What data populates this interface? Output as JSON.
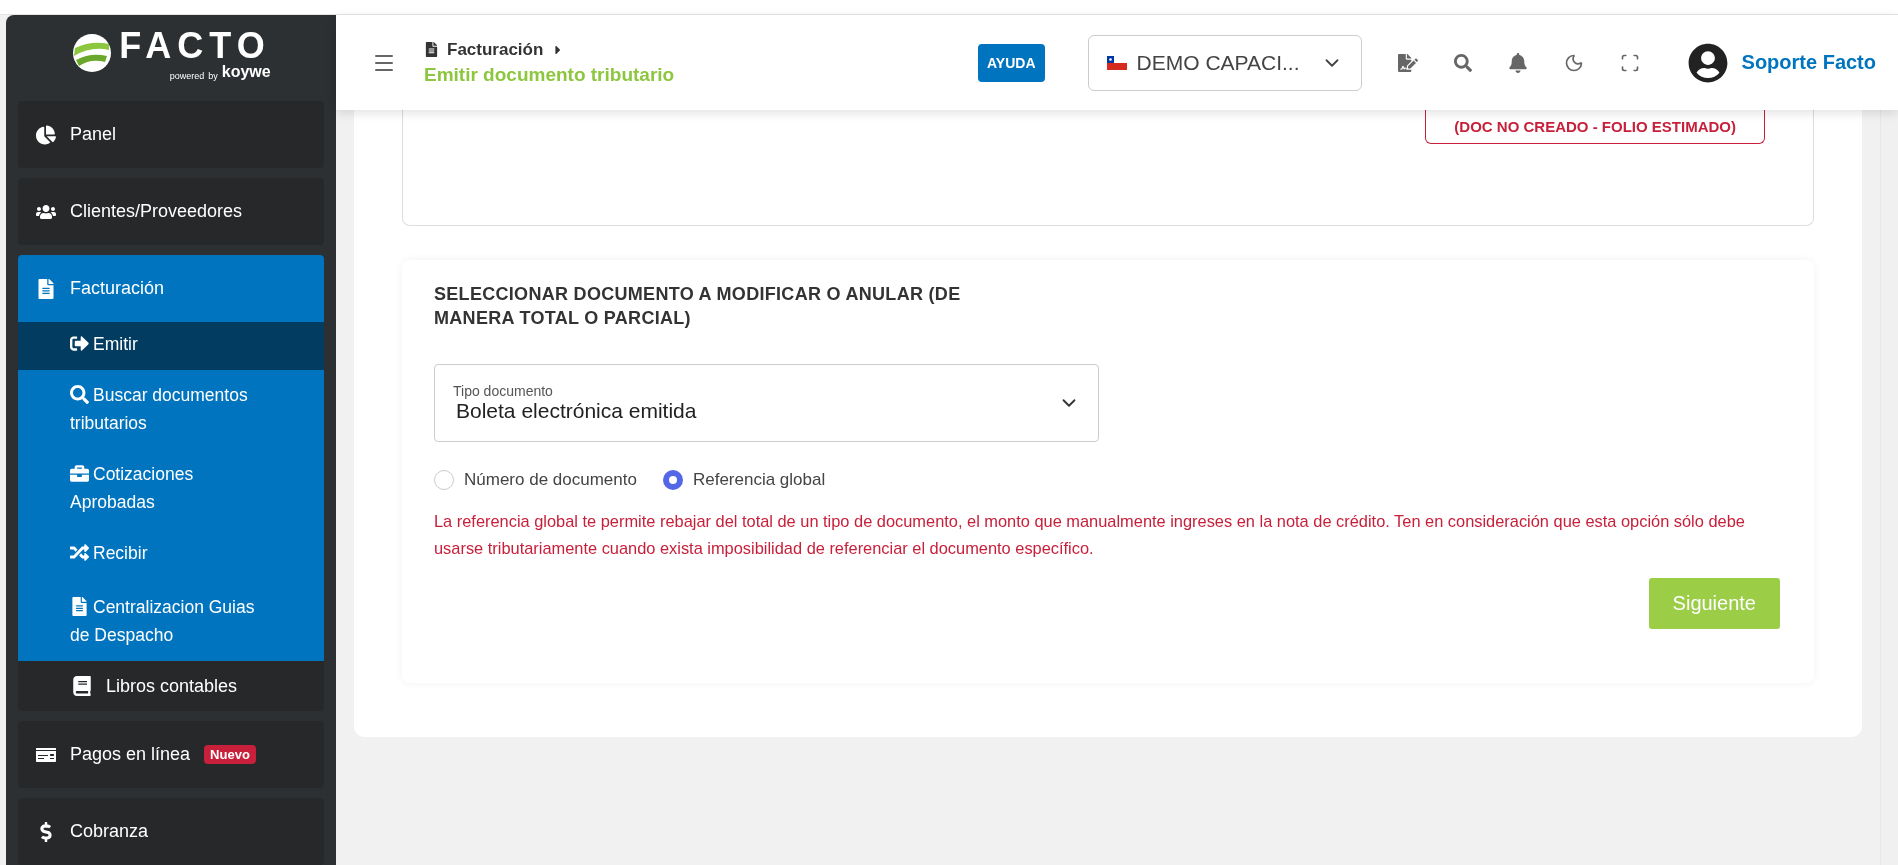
{
  "logo": {
    "name": "FACTO",
    "powered": "powered",
    "by": "by",
    "brand": "koywe"
  },
  "sidebar": {
    "items": [
      {
        "label": "Panel",
        "expanded": false
      },
      {
        "label": "Clientes/Proveedores",
        "expanded": false
      },
      {
        "label": "Facturación",
        "expanded": true,
        "children": [
          {
            "label": "Emitir",
            "selected": true
          },
          {
            "label": "Buscar documentos tributarios",
            "selected": false
          },
          {
            "label": "Cotizaciones Aprobadas",
            "selected": false
          },
          {
            "label": "Recibir",
            "selected": false
          },
          {
            "label": "Centralizacion Guias de Despacho",
            "selected": false
          }
        ]
      },
      {
        "label": "Libros contables",
        "kind": "attached",
        "expanded": false
      },
      {
        "label": "Pagos en línea",
        "badge": "Nuevo",
        "expanded": false
      },
      {
        "label": "Cobranza",
        "expanded": false
      }
    ]
  },
  "header": {
    "section": "Facturación",
    "page": "Emitir documento tributario",
    "help": "AYUDA",
    "company": "DEMO CAPACI...",
    "user": "Soporte Facto"
  },
  "status_box": "(DOC NO CREADO - FOLIO ESTIMADO)",
  "form": {
    "title": "SELECCIONAR DOCUMENTO A MODIFICAR O ANULAR (DE MANERA TOTAL O PARCIAL)",
    "select": {
      "label": "Tipo documento",
      "value": "Boleta electrónica emitida"
    },
    "radios": [
      {
        "label": "Número de documento",
        "selected": false
      },
      {
        "label": "Referencia global",
        "selected": true
      }
    ],
    "note": "La referencia global te permite rebajar del total de un tipo de documento, el monto que manualmente ingreses en la nota de crédito. Ten en consideración que esta opción sólo debe usarse tributariamente cuando exista imposibilidad de referenciar el documento específico.",
    "next": "Siguiente"
  }
}
